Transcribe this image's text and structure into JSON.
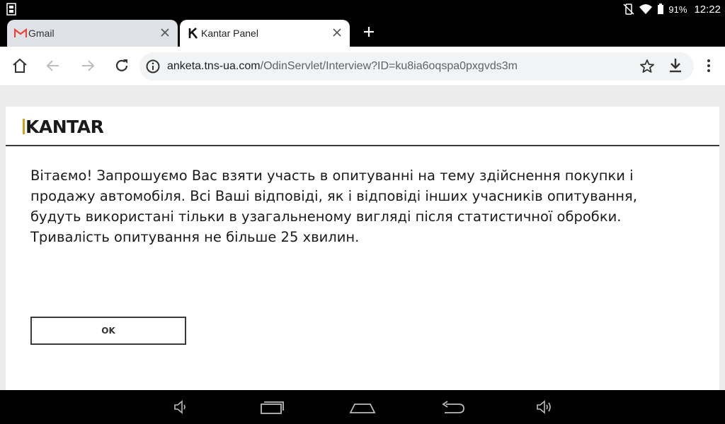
{
  "status_bar": {
    "battery": "91%",
    "time": "12:22"
  },
  "tabs": [
    {
      "title": "Gmail",
      "active": false,
      "favicon": "gmail-icon"
    },
    {
      "title": "Kantar Panel",
      "active": true,
      "favicon": "kantar-k-icon"
    }
  ],
  "omnibox": {
    "host": "anketa.tns-ua.com",
    "path": "/OdinServlet/Interview?ID=ku8ia6oqspa0pxgvds3m"
  },
  "page": {
    "brand": "KANTAR",
    "message_lines": [
      "Вітаємо! Запрошуємо Вас взяти участь в опитуванні на тему здійснення покупки і",
      "продажу автомобіля. Всі Ваші відповіді, як і відповіді інших учасників опитування,",
      "будуть використані тільки в узагальненому вигляді після статистичної обробки.",
      "Тривалість опитування не більше 25 хвилин."
    ],
    "ok_label": "OK"
  },
  "colors": {
    "brand_accent": "#d4a017",
    "gmail_red": "#ea4335"
  }
}
